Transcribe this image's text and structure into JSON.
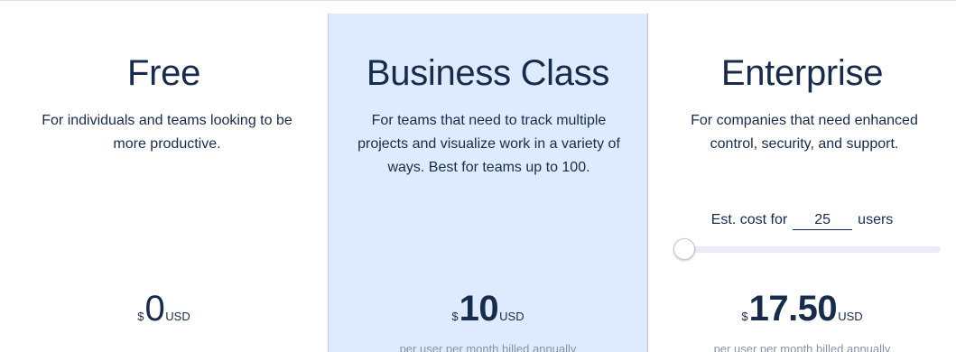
{
  "plans": [
    {
      "title": "Free",
      "description": "For individuals and teams looking to be more productive.",
      "currency": "$",
      "price": "0",
      "unit": "USD"
    },
    {
      "title": "Business Class",
      "description": "For teams that need to track multiple projects and visualize work in a variety of ways. Best for teams up to 100.",
      "currency": "$",
      "price": "10",
      "unit": "USD",
      "billing": "per user per month billed annually"
    },
    {
      "title": "Enterprise",
      "description": "For companies that need enhanced control, security, and support.",
      "est_cost_label": "Est. cost for",
      "users_value": "25",
      "users_label": "users",
      "slider_fraction": 0.0,
      "currency": "$",
      "price": "17.50",
      "unit": "USD",
      "billing": "per user per month billed annually"
    }
  ],
  "colors": {
    "text": "#172b4d",
    "highlight_bg": "#deebff",
    "muted": "#8993a4",
    "slider_track": "#e9ebf8"
  }
}
